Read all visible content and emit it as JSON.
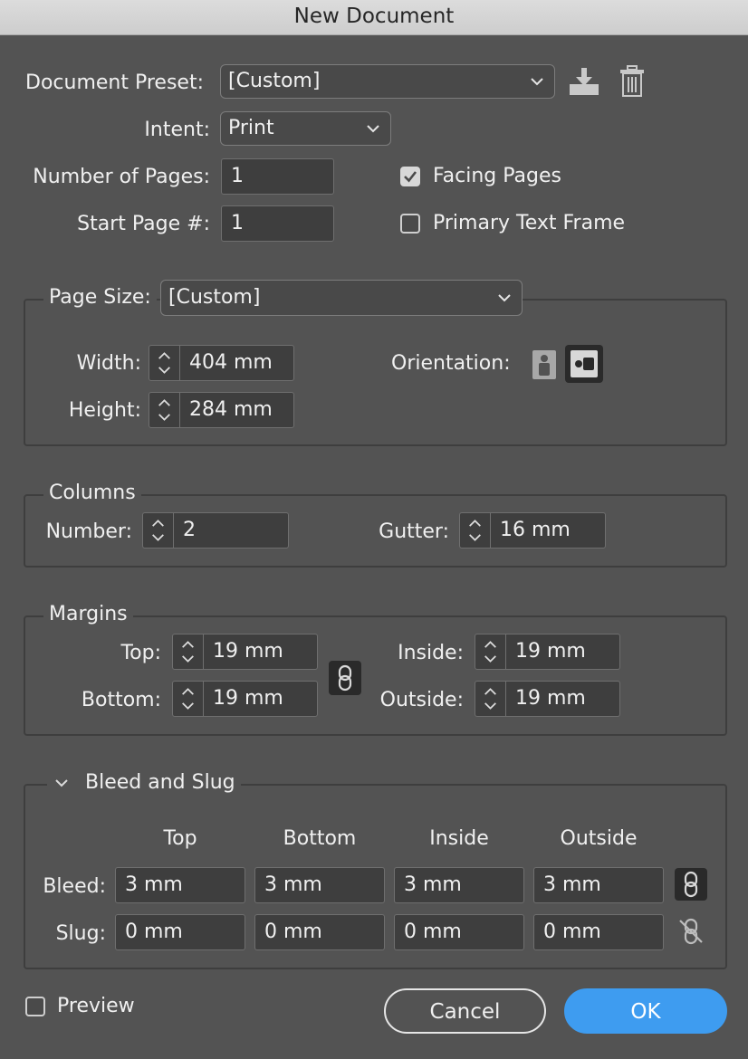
{
  "window": {
    "title": "New Document"
  },
  "preset": {
    "label": "Document Preset:",
    "value": "[Custom]"
  },
  "intent": {
    "label": "Intent:",
    "value": "Print"
  },
  "pages": {
    "number_label": "Number of Pages:",
    "number_value": "1",
    "start_label": "Start Page #:",
    "start_value": "1",
    "facing_label": "Facing Pages",
    "facing_checked": true,
    "primary_label": "Primary Text Frame",
    "primary_checked": false
  },
  "page_size": {
    "label": "Page Size:",
    "value": "[Custom]",
    "width_label": "Width:",
    "width_value": "404 mm",
    "height_label": "Height:",
    "height_value": "284 mm",
    "orientation_label": "Orientation:",
    "orientation_selected": "landscape"
  },
  "columns": {
    "title": "Columns",
    "number_label": "Number:",
    "number_value": "2",
    "gutter_label": "Gutter:",
    "gutter_value": "16 mm"
  },
  "margins": {
    "title": "Margins",
    "top_label": "Top:",
    "top_value": "19 mm",
    "bottom_label": "Bottom:",
    "bottom_value": "19 mm",
    "inside_label": "Inside:",
    "inside_value": "19 mm",
    "outside_label": "Outside:",
    "outside_value": "19 mm"
  },
  "bleed_slug": {
    "title": "Bleed and Slug",
    "col_headers": [
      "Top",
      "Bottom",
      "Inside",
      "Outside"
    ],
    "bleed_label": "Bleed:",
    "bleed_values": [
      "3 mm",
      "3 mm",
      "3 mm",
      "3 mm"
    ],
    "slug_label": "Slug:",
    "slug_values": [
      "0 mm",
      "0 mm",
      "0 mm",
      "0 mm"
    ]
  },
  "footer": {
    "preview_label": "Preview",
    "preview_checked": false,
    "cancel_label": "Cancel",
    "ok_label": "OK"
  },
  "colors": {
    "dialog_bg": "#535353",
    "field_bg": "#3e3e3e",
    "accent": "#3e9cf0"
  }
}
